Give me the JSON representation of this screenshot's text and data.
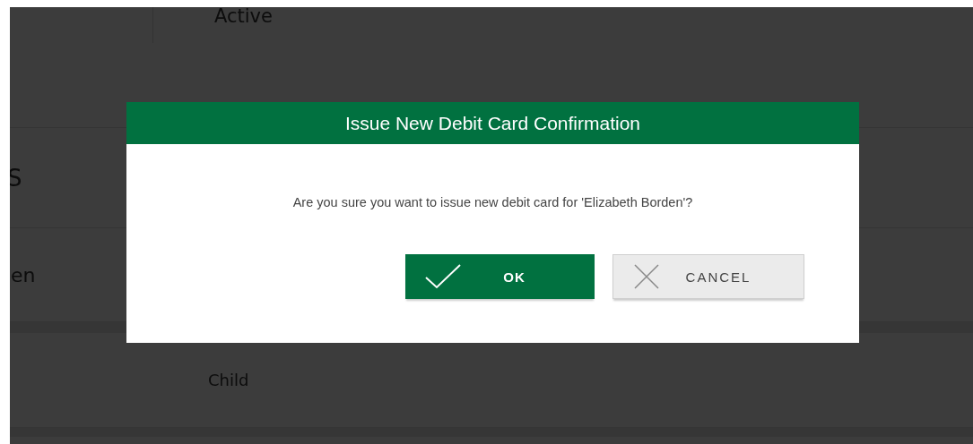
{
  "background": {
    "rows": [
      {
        "kind": "status",
        "text": "Active"
      },
      {
        "kind": "heading",
        "text": "S"
      },
      {
        "kind": "name",
        "text": "en"
      },
      {
        "kind": "relation",
        "text": "Child"
      }
    ]
  },
  "dialog": {
    "title": "Issue New Debit Card Confirmation",
    "message": "Are you sure you want to issue new debit card for 'Elizabeth Borden'?",
    "buttons": [
      {
        "kind": "confirm",
        "label": "OK"
      },
      {
        "kind": "cancel",
        "label": "CANCEL"
      }
    ]
  }
}
